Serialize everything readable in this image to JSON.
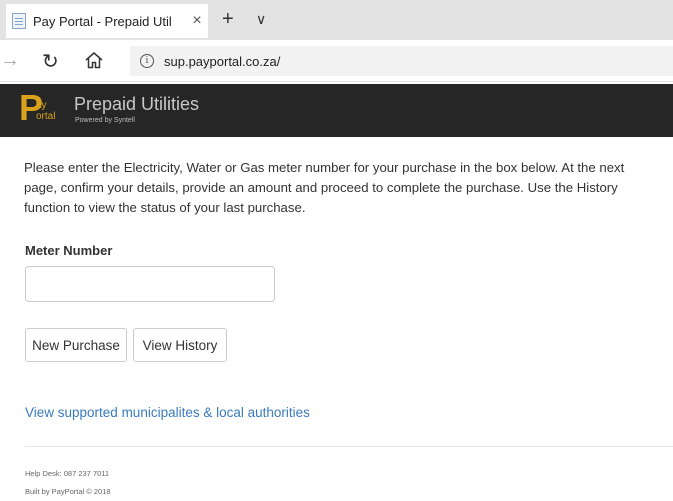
{
  "browser": {
    "tab_title": "Pay Portal - Prepaid Util",
    "tab_close": "×",
    "new_tab": "+",
    "tab_list": "∨",
    "url": "sup.payportal.co.za/",
    "url_info": "i"
  },
  "header": {
    "logo": {
      "p": "P",
      "ay": "ay",
      "ortal": "ortal"
    },
    "title": "Prepaid Utilities",
    "subtitle": "Powered by Syntell",
    "logo_color": "#d9a21a",
    "background": "#262626"
  },
  "main": {
    "intro": "Please enter the Electricity, Water or Gas meter number for your purchase in the box below. At the next page, confirm your details, provide an amount and proceed to complete the purchase. Use the History function to view the status of your last purchase.",
    "meter_label": "Meter Number",
    "meter_value": "",
    "buttons": {
      "new_purchase": "New Purchase",
      "view_history": "View History"
    },
    "municipalities_link": "View supported municipalites & local authorities",
    "link_color": "#3a7bbf"
  },
  "footer": {
    "helpdesk": "Help Desk: 087 237 7011",
    "built_by": "Built by PayPortal © 2018"
  }
}
